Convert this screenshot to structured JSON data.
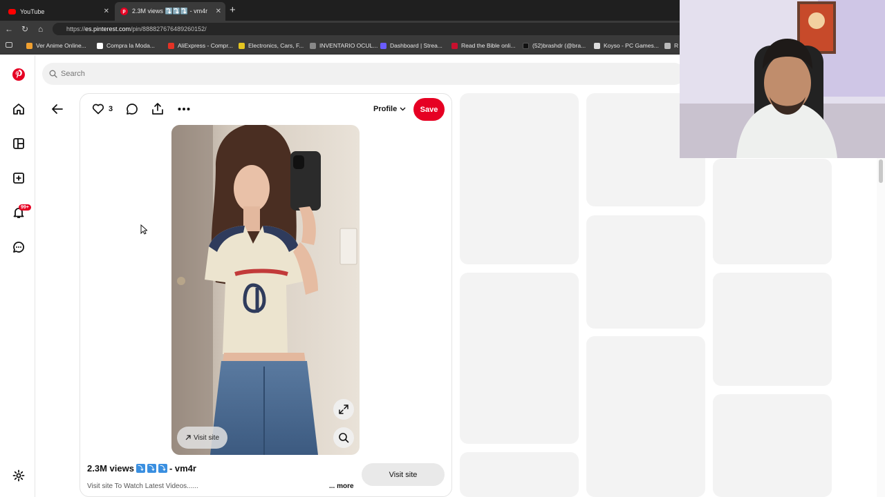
{
  "browser": {
    "tabs": [
      {
        "title": "YouTube",
        "favicon": "youtube-icon",
        "active": false
      },
      {
        "title": "2.3M views ⤵️⤵️⤵️ - vm4r",
        "favicon": "pinterest-icon",
        "active": true
      }
    ],
    "url_prefix": "https://",
    "url_host": "es.pinterest.com",
    "url_path": "/pin/888827676489260152/",
    "bookmarks": [
      "Ver Anime Online...",
      "Compra la Moda...",
      "AliExpress - Compr...",
      "Electronics, Cars, F...",
      "INVENTARIO OCUL...",
      "Dashboard | Strea...",
      "Read the Bible onli...",
      "(52)brashdr (@bra...",
      "Koyso - PC Games...",
      "R"
    ]
  },
  "sidebar": {
    "notification_badge": "99+"
  },
  "search": {
    "placeholder": "Search"
  },
  "pin": {
    "like_count": "3",
    "profile_label": "Profile",
    "save_label": "Save",
    "overlay_visit_label": "Visit site",
    "title_prefix": "2.3M views",
    "title_suffix": "- vm4r",
    "title_emoji": [
      "⤵",
      "⤵",
      "⤵"
    ],
    "description": "Visit site To Watch Latest Videos......",
    "more_label": "... more",
    "visit_label": "Visit site"
  },
  "colors": {
    "brand": "#e60023",
    "placeholder": "#f3f3f3"
  }
}
